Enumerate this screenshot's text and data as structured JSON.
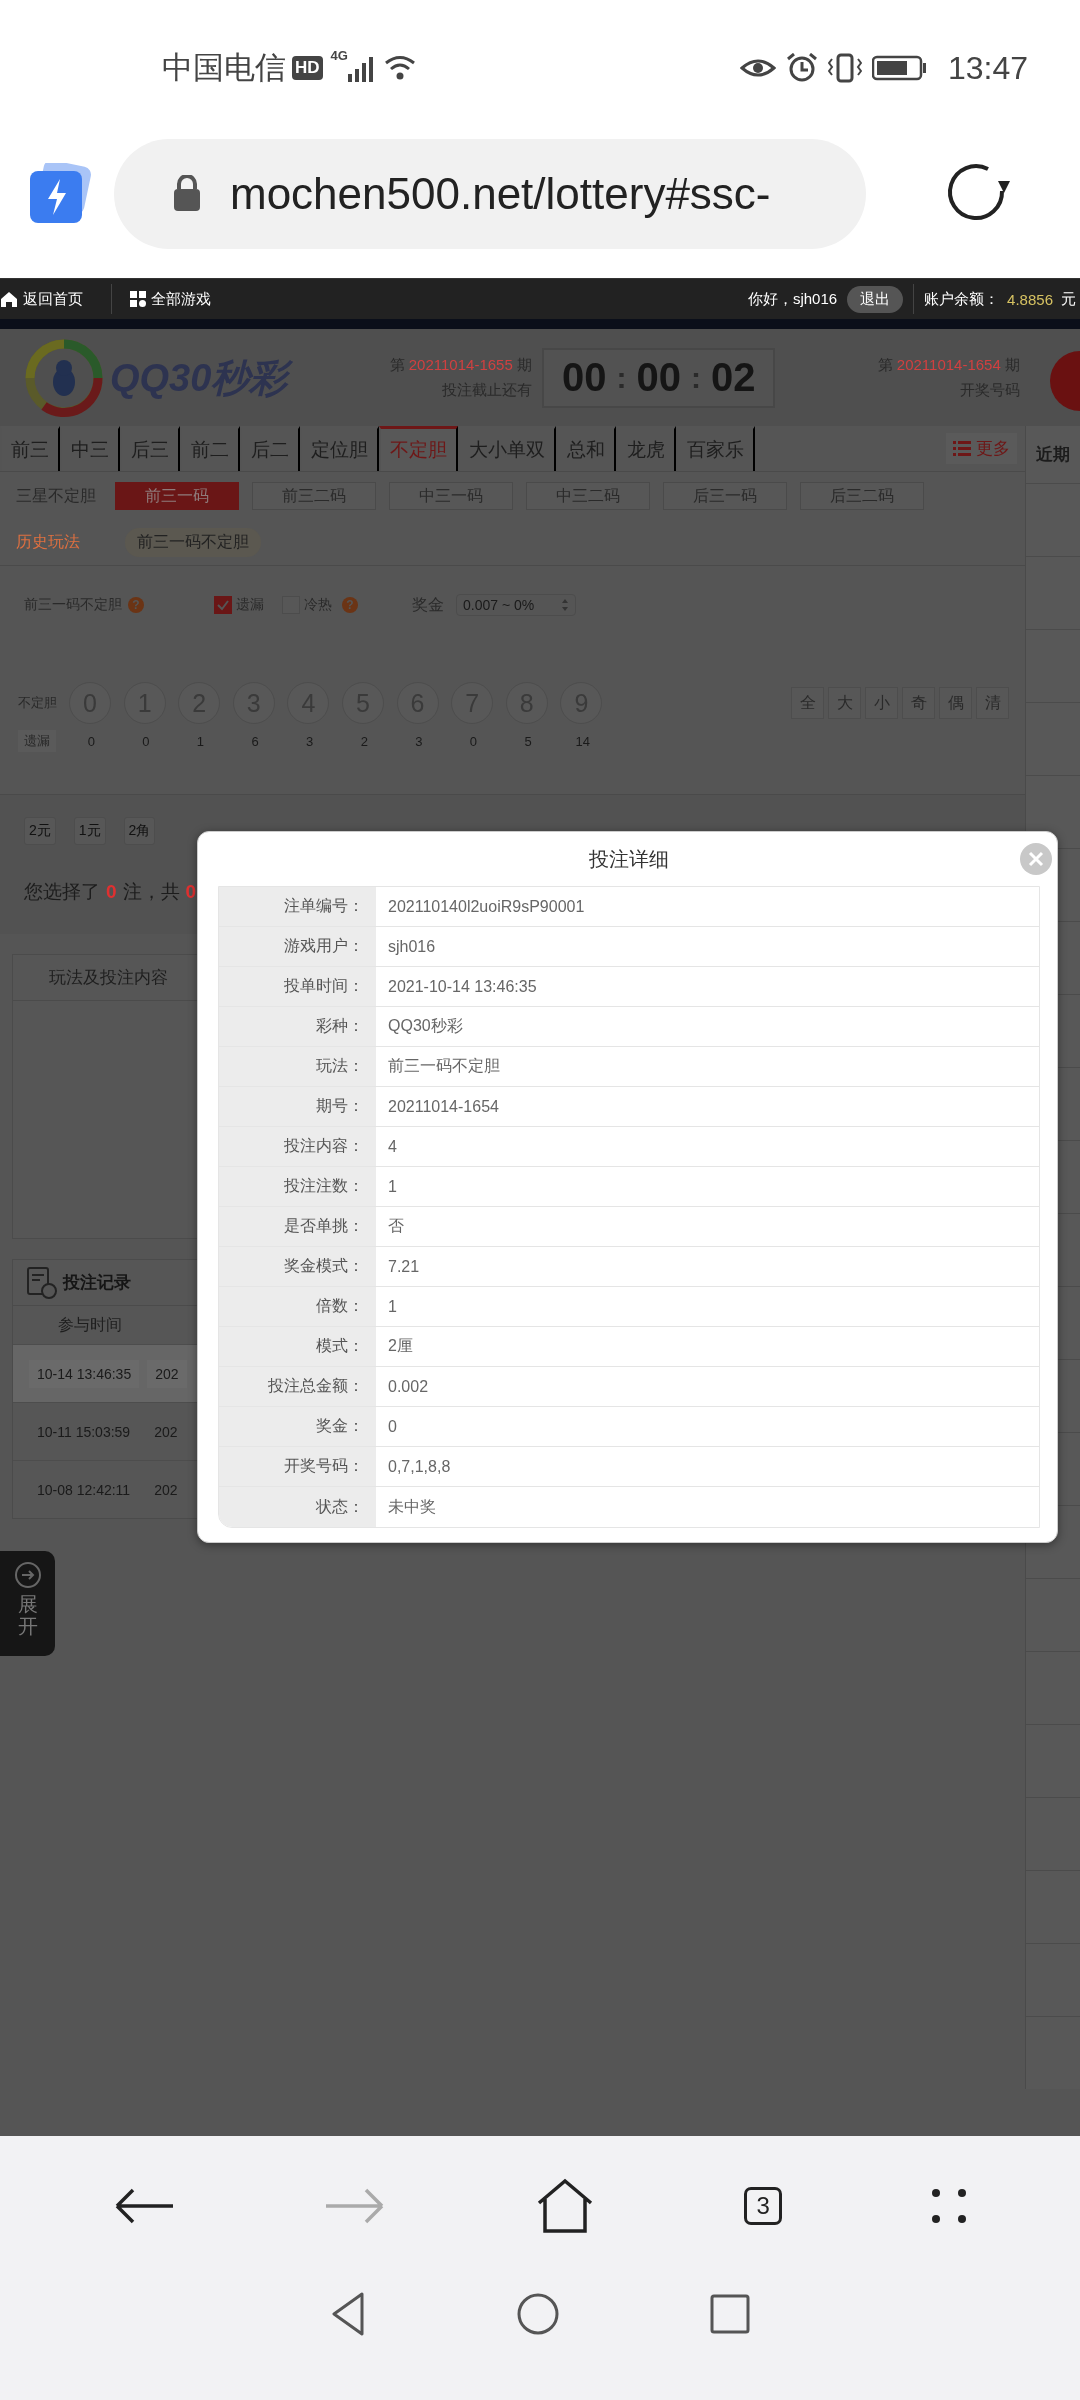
{
  "status_bar": {
    "carrier": "中国电信",
    "hd_badge": "HD",
    "network": "4G",
    "time": "13:47"
  },
  "address_bar": {
    "url": "mochen500.net/lottery#ssc-"
  },
  "top_nav": {
    "home": "返回首页",
    "all_games": "全部游戏",
    "greeting": "你好，sjh016",
    "logout": "退出",
    "balance_label": "账户余额：",
    "balance": "4.8856",
    "currency": "元"
  },
  "header": {
    "logo": "QQ30秒彩",
    "current": {
      "prefix": "第",
      "period": "20211014-1655",
      "suffix": "期",
      "note": "投注截止还有"
    },
    "countdown": [
      {
        "kind": "digits",
        "text": "00"
      },
      {
        "kind": "separator",
        "text": ":"
      },
      {
        "kind": "digits",
        "text": "00"
      },
      {
        "kind": "separator",
        "text": ":"
      },
      {
        "kind": "digits",
        "text": "02"
      }
    ],
    "last": {
      "prefix": "第",
      "period": "20211014-1654",
      "suffix": "期",
      "note": "开奖号码"
    }
  },
  "play_tabs": [
    {
      "label": "前三",
      "selected": false
    },
    {
      "label": "中三",
      "selected": false
    },
    {
      "label": "后三",
      "selected": false
    },
    {
      "label": "前二",
      "selected": false
    },
    {
      "label": "后二",
      "selected": false
    },
    {
      "label": "定位胆",
      "selected": false
    },
    {
      "label": "不定胆",
      "selected": true
    },
    {
      "label": "大小单双",
      "selected": false
    },
    {
      "label": "总和",
      "selected": false
    },
    {
      "label": "龙虎",
      "selected": false
    },
    {
      "label": "百家乐",
      "selected": false
    }
  ],
  "more": "更多",
  "sub_tabs": {
    "group": "三星不定胆",
    "items": [
      {
        "label": "前三一码",
        "selected": true
      },
      {
        "label": "前三二码",
        "selected": false
      },
      {
        "label": "中三一码",
        "selected": false
      },
      {
        "label": "中三二码",
        "selected": false
      },
      {
        "label": "后三一码",
        "selected": false
      },
      {
        "label": "后三二码",
        "selected": false
      }
    ]
  },
  "history": {
    "label": "历史玩法",
    "items": [
      "前三一码不定胆"
    ]
  },
  "options": {
    "play_name": "前三一码不定胆",
    "help": "?",
    "checks": [
      {
        "label": "遗漏",
        "checked": true
      },
      {
        "label": "冷热",
        "checked": false,
        "help": "?"
      }
    ],
    "prize_label": "奖金",
    "prize_value": "0.007 ~ 0%"
  },
  "balls": {
    "label": "不定胆",
    "miss_label": "遗漏",
    "numbers": [
      {
        "digit": "0",
        "miss": "0"
      },
      {
        "digit": "1",
        "miss": "0"
      },
      {
        "digit": "2",
        "miss": "1"
      },
      {
        "digit": "3",
        "miss": "6"
      },
      {
        "digit": "4",
        "miss": "3"
      },
      {
        "digit": "5",
        "miss": "2"
      },
      {
        "digit": "6",
        "miss": "3"
      },
      {
        "digit": "7",
        "miss": "0"
      },
      {
        "digit": "8",
        "miss": "5"
      },
      {
        "digit": "9",
        "miss": "14"
      }
    ],
    "quick": [
      "全",
      "大",
      "小",
      "奇",
      "偶",
      "清"
    ]
  },
  "units": [
    "2元",
    "1元",
    "2角"
  ],
  "selection": {
    "prefix": "您选择了",
    "count": "0",
    "middle": "注，共",
    "total": "0"
  },
  "content_panel": {
    "title": "玩法及投注内容"
  },
  "records": {
    "title": "投注记录",
    "columns": [
      "参与时间"
    ],
    "rows": [
      {
        "time": "10-14 13:46:35",
        "column_2": "202",
        "selected": true
      },
      {
        "time": "10-11 15:03:59",
        "column_2": "202",
        "selected": false
      },
      {
        "time": "10-08 12:42:11",
        "column_2": "202",
        "selected": false
      }
    ]
  },
  "side_panel": {
    "title": "近期"
  },
  "expand_tab": {
    "label": "展开"
  },
  "dialog": {
    "title": "投注详细",
    "fields": [
      {
        "label": "注单编号：",
        "value": "202110140l2uoiR9sP90001"
      },
      {
        "label": "游戏用户：",
        "value": "sjh016"
      },
      {
        "label": "投单时间：",
        "value": "2021-10-14 13:46:35"
      },
      {
        "label": "彩种：",
        "value": "QQ30秒彩"
      },
      {
        "label": "玩法：",
        "value": "前三一码不定胆"
      },
      {
        "label": "期号：",
        "value": "20211014-1654"
      },
      {
        "label": "投注内容：",
        "value": "4"
      },
      {
        "label": "投注注数：",
        "value": "1"
      },
      {
        "label": "是否单挑：",
        "value": "否"
      },
      {
        "label": "奖金模式：",
        "value": "7.21"
      },
      {
        "label": "倍数：",
        "value": "1"
      },
      {
        "label": "模式：",
        "value": "2厘"
      },
      {
        "label": "投注总金额：",
        "value": "0.002"
      },
      {
        "label": "奖金：",
        "value": "0"
      },
      {
        "label": "开奖号码：",
        "value": "0,7,1,8,8"
      },
      {
        "label": "状态：",
        "value": "未中奖"
      }
    ]
  },
  "browser_nav": {
    "tabs_count": "3"
  }
}
